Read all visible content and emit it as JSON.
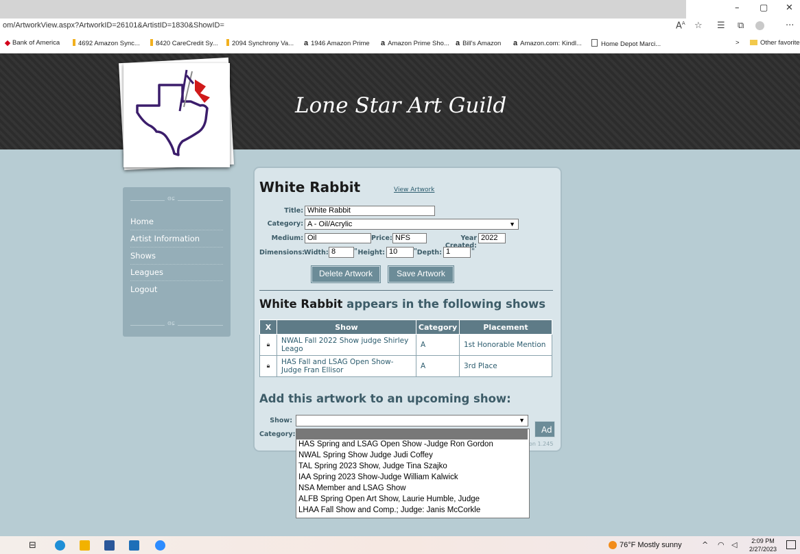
{
  "browser": {
    "url": "om/ArtworkView.aspx?ArtworkID=26101&ArtistID=1830&ShowID=",
    "window_controls": {
      "minimize": "–",
      "restore": "▢",
      "close": "✕"
    },
    "favorites": [
      {
        "label": "Bank of America",
        "icon_color": "#d4001a"
      },
      {
        "label": "4692 Amazon Sync...",
        "icon_color": "#f2b01e"
      },
      {
        "label": "8420 CareCredit Sy...",
        "icon_color": "#f2b01e"
      },
      {
        "label": "2094 Synchrony Va...",
        "icon_color": "#f2b01e"
      },
      {
        "label": "1946 Amazon Prime",
        "icon_color": "#111111"
      },
      {
        "label": "Amazon Prime Sho...",
        "icon_color": "#111111"
      },
      {
        "label": "Bill's Amazon",
        "icon_color": "#111111"
      },
      {
        "label": "Amazon.com: Kindl...",
        "icon_color": "#111111"
      },
      {
        "label": "Home Depot Marci...",
        "icon_color": "#555555"
      }
    ],
    "other_favorites": "Other favorite",
    "more_chevron": ">"
  },
  "site": {
    "title": "Lone Star Art Guild"
  },
  "sidebar": {
    "items": [
      {
        "label": "Home"
      },
      {
        "label": "Artist Information"
      },
      {
        "label": "Shows"
      },
      {
        "label": "Leagues"
      },
      {
        "label": "Logout"
      }
    ],
    "ornament": "ɞɕ"
  },
  "artwork": {
    "heading": "White Rabbit",
    "view_link": "View Artwork",
    "labels": {
      "title": "Title:",
      "category": "Category:",
      "medium": "Medium:",
      "price": "Price:",
      "year": "Year Created:",
      "dimensions": "Dimensions:",
      "width": "Width:",
      "height": "Height:",
      "depth": "Depth:",
      "inch": "\""
    },
    "values": {
      "title": "White Rabbit",
      "category": "A - Oil/Acrylic",
      "medium": "Oil",
      "price": "NFS",
      "year": "2022",
      "width": "8",
      "height": "10",
      "depth": "1"
    },
    "buttons": {
      "delete": "Delete Artwork",
      "save": "Save Artwork"
    }
  },
  "shows_section": {
    "heading_name": "White Rabbit",
    "heading_rest": " appears in the following shows",
    "columns": [
      "X",
      "Show",
      "Category",
      "Placement"
    ],
    "rows": [
      {
        "show": "NWAL Fall 2022 Show judge Shirley Leago",
        "category": "A",
        "placement": "1st Honorable Mention"
      },
      {
        "show": "HAS Fall and LSAG Open Show- Judge Fran Ellisor",
        "category": "A",
        "placement": "3rd Place"
      }
    ]
  },
  "add_section": {
    "heading": "Add this artwork to an upcoming show:",
    "show_label": "Show:",
    "category_label": "Category:",
    "add_button": "Ad",
    "version": "on 1.245",
    "options": [
      "HAS Spring and LSAG Open Show -Judge Ron Gordon",
      "NWAL Spring Show Judge Judi Coffey",
      "TAL Spring 2023 Show, Judge Tina Szajko",
      "IAA Spring 2023 Show-Judge William Kalwick",
      "NSA Member and LSAG Show",
      "ALFB Spring Open Art Show, Laurie Humble, Judge",
      "LHAA Fall Show and Comp.; Judge: Janis McCorkle"
    ]
  },
  "taskbar": {
    "weather": "76°F  Mostly sunny",
    "time": "2:09 PM",
    "date": "2/27/2023"
  }
}
